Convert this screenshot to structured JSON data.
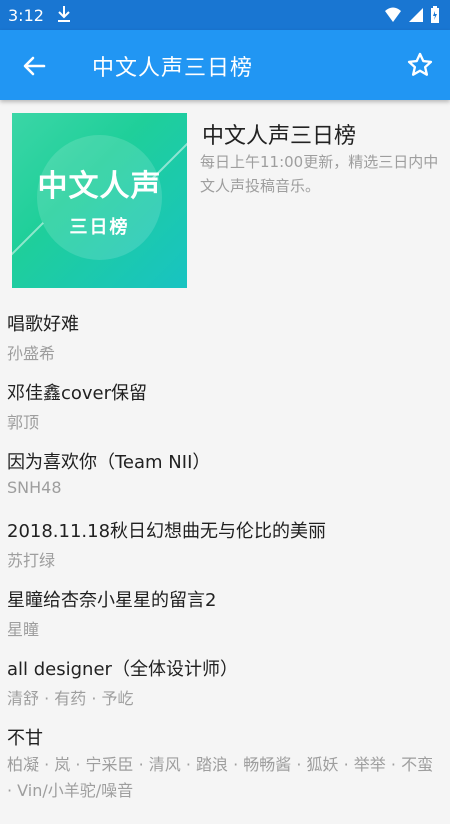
{
  "status_bar": {
    "time": "3:12"
  },
  "app_bar": {
    "title": "中文人声三日榜"
  },
  "playlist": {
    "cover_text_main": "中文人声",
    "cover_text_sub": "三日榜",
    "name": "中文人声三日榜",
    "description": "每日上午11:00更新，精选三日内中文人声投稿音乐。"
  },
  "songs": [
    {
      "title": "唱歌好难",
      "artist": "孙盛希"
    },
    {
      "title": "邓佳鑫cover保留",
      "artist": "郭顶"
    },
    {
      "title": "因为喜欢你（Team NII）",
      "artist": "SNH48"
    },
    {
      "title": "2018.11.18秋日幻想曲无与伦比的美丽",
      "artist": "苏打绿"
    },
    {
      "title": "星瞳给杏奈小星星的留言2",
      "artist": "星瞳"
    },
    {
      "title": "all designer（全体设计师）",
      "artist": "清舒 · 有药 · 予屹"
    },
    {
      "title": "不甘",
      "artist": "柏凝 · 岚 · 宁采臣 · 清风 · 踏浪 · 畅畅酱 · 狐妖 · 举举 · 不蛮 · Vin/小羊驼/噪音"
    }
  ],
  "colors": {
    "app_bar": "#2196f3",
    "status_bar": "#1976d2"
  },
  "icons": {
    "back": "arrow-back-icon",
    "favorite": "star-outline-icon"
  }
}
